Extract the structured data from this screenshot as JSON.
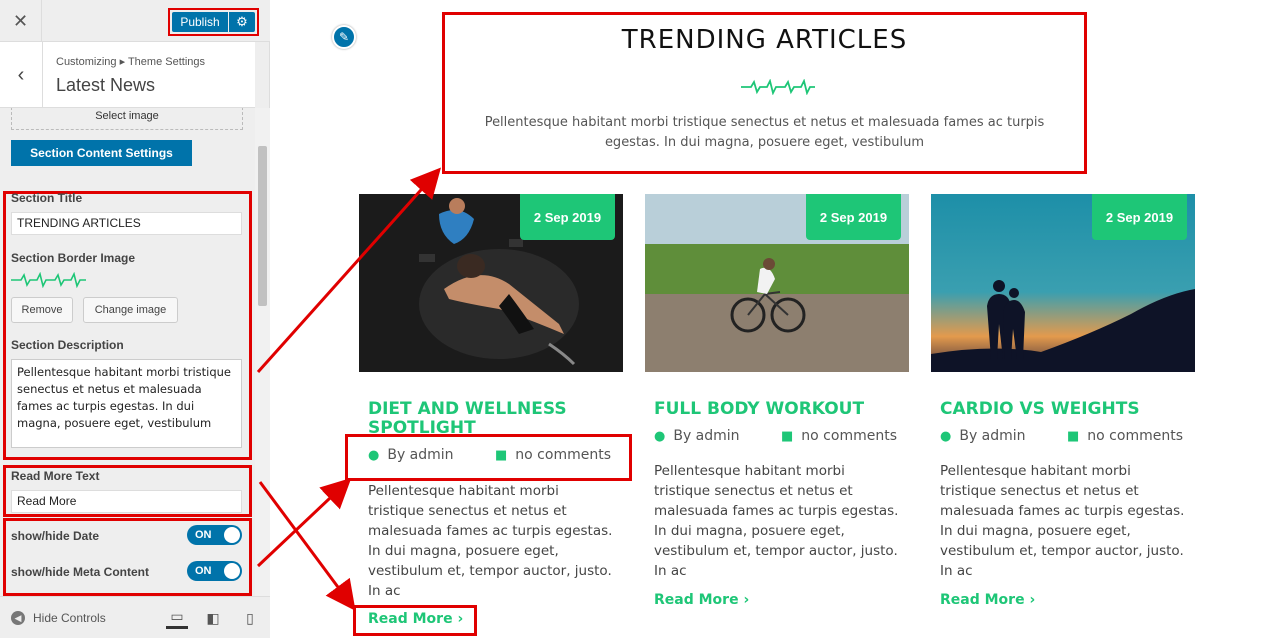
{
  "customizer": {
    "close_label": "✕",
    "publish_label": "Publish",
    "gear_icon": "gear-icon",
    "breadcrumb": "Customizing ▸ Theme Settings",
    "section_name": "Latest News",
    "select_image_label": "Select image",
    "section_content_button": "Section Content Settings",
    "fields": {
      "section_title_label": "Section Title",
      "section_title_value": "TRENDING ARTICLES",
      "border_image_label": "Section Border Image",
      "remove_label": "Remove",
      "change_image_label": "Change image",
      "description_label": "Section Description",
      "description_value": "Pellentesque habitant morbi tristique senectus et netus et malesuada fames ac turpis egestas. In dui magna, posuere eget, vestibulum",
      "read_more_label": "Read More Text",
      "read_more_value": "Read More",
      "show_date_label": "show/hide Date",
      "show_date_state": "ON",
      "show_meta_label": "show/hide Meta Content",
      "show_meta_state": "ON"
    },
    "hide_controls_label": "Hide Controls"
  },
  "preview": {
    "heading": "TRENDING ARTICLES",
    "description": "Pellentesque habitant morbi tristique senectus et netus et malesuada fames ac turpis egestas. In dui magna, posuere eget, vestibulum",
    "accent_color": "#1ec677",
    "cards": [
      {
        "date": "2 Sep 2019",
        "title": "DIET AND WELLNESS SPOTLIGHT",
        "author": "By admin",
        "comments": "no comments",
        "excerpt": "Pellentesque habitant morbi tristique senectus et netus et malesuada fames ac turpis egestas. In dui magna, posuere eget, vestibulum et, tempor auctor, justo. In ac",
        "read_more": "Read More"
      },
      {
        "date": "2 Sep 2019",
        "title": "FULL BODY WORKOUT",
        "author": "By admin",
        "comments": "no comments",
        "excerpt": "Pellentesque habitant morbi tristique senectus et netus et malesuada fames ac turpis egestas. In dui magna, posuere eget, vestibulum et, tempor auctor, justo. In ac",
        "read_more": "Read More"
      },
      {
        "date": "2 Sep 2019",
        "title": "CARDIO VS WEIGHTS",
        "author": "By admin",
        "comments": "no comments",
        "excerpt": "Pellentesque habitant morbi tristique senectus et netus et malesuada fames ac turpis egestas. In dui magna, posuere eget, vestibulum et, tempor auctor, justo. In ac",
        "read_more": "Read More"
      }
    ]
  }
}
